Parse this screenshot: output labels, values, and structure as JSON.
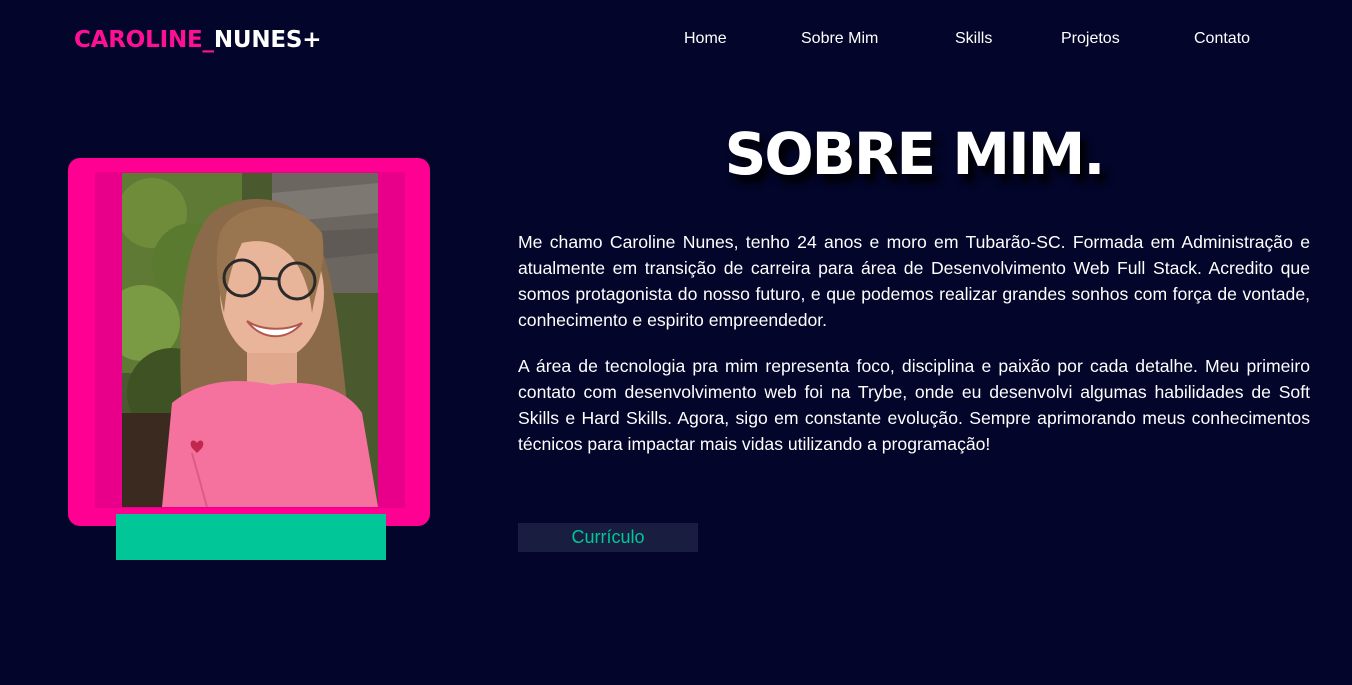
{
  "header": {
    "logo_part1": "CAROLINE_",
    "logo_part2": "NUNES+",
    "nav": [
      "Home",
      "Sobre Mim",
      "Skills",
      "Projetos",
      "Contato"
    ]
  },
  "about": {
    "title": "SOBRE MIM.",
    "paragraphs": [
      "Me chamo Caroline Nunes, tenho 24 anos e moro em Tubarão-SC. Formada em Administração e atualmente em transição de carreira para área de Desenvolvimento Web Full Stack. Acredito que somos protagonista do nosso futuro, e que podemos realizar grandes sonhos com força de vontade, conhecimento e espirito empreendedor.",
      "A área de tecnologia pra mim representa foco, disciplina e paixão por cada detalhe. Meu primeiro contato com desenvolvimento web foi na Trybe, onde eu desenvolvi algumas habilidades de Soft Skills e Hard Skills. Agora, sigo em constante evolução. Sempre aprimorando meus conhecimentos técnicos para impactar mais vidas utilizando a programação!"
    ],
    "cv_button": "Currículo"
  },
  "colors": {
    "background": "#03052a",
    "accent_pink": "#ff0093",
    "accent_green": "#00c698"
  }
}
